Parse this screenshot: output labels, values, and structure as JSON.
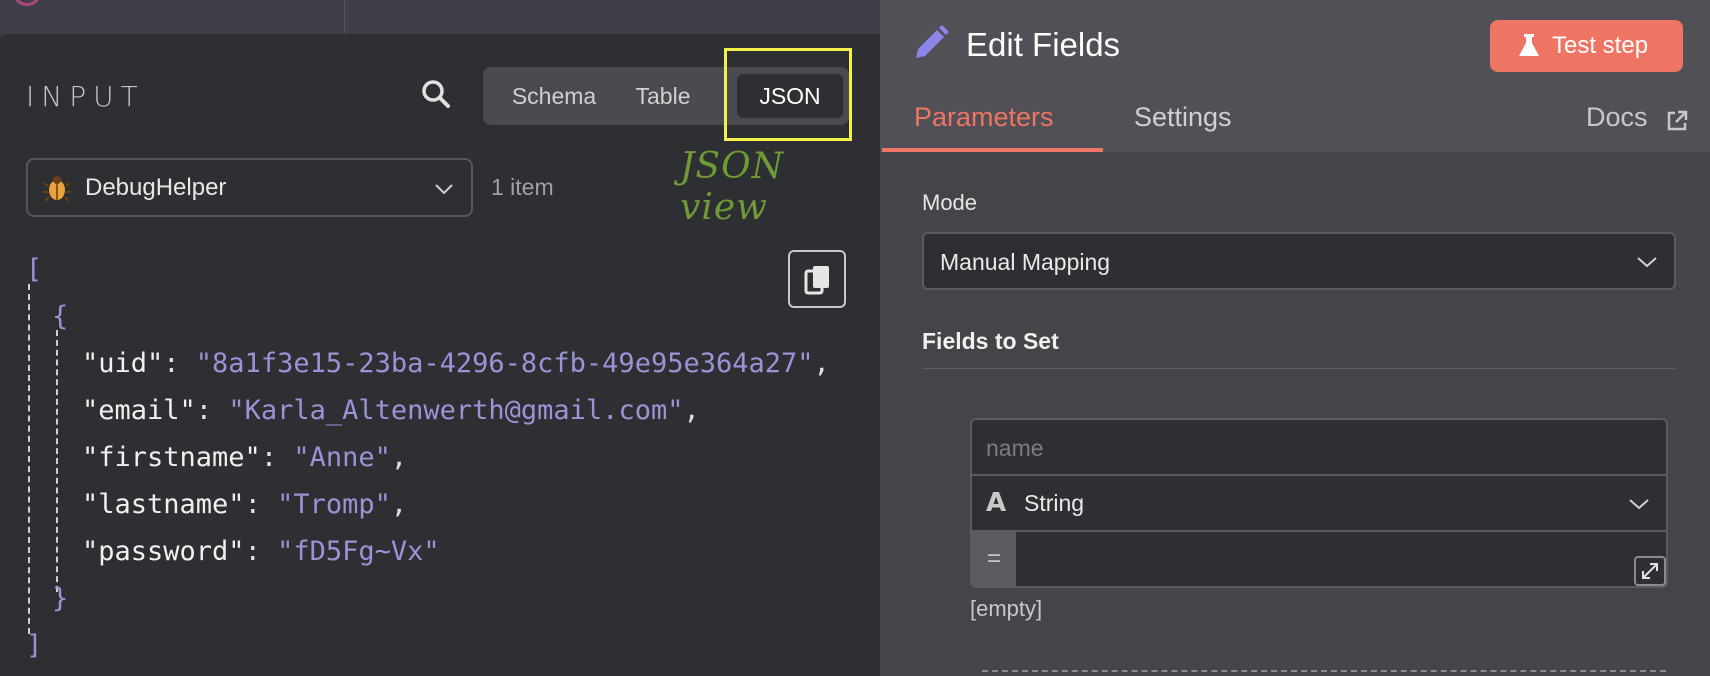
{
  "input_panel": {
    "title": "INPUT",
    "view_tabs": [
      {
        "label": "Schema",
        "active": false
      },
      {
        "label": "Table",
        "active": false
      },
      {
        "label": "JSON",
        "active": true
      }
    ],
    "annotation": "JSON view",
    "node_select": {
      "value": "DebugHelper",
      "icon": "bug-icon"
    },
    "item_count": "1 item",
    "json": {
      "open_array": "[",
      "open_object": "{",
      "entries": [
        {
          "key": "\"uid\"",
          "value": "\"8a1f3e15-23ba-4296-8cfb-49e95e364a27\"",
          "comma": ","
        },
        {
          "key": "\"email\"",
          "value": "\"Karla_Altenwerth@gmail.com\"",
          "comma": ","
        },
        {
          "key": "\"firstname\"",
          "value": "\"Anne\"",
          "comma": ","
        },
        {
          "key": "\"lastname\"",
          "value": "\"Tromp\"",
          "comma": ","
        },
        {
          "key": "\"password\"",
          "value": "\"fD5Fg~Vx\"",
          "comma": ""
        }
      ],
      "close_object": "}",
      "close_array": "]",
      "colon": ": "
    }
  },
  "right_panel": {
    "title": "Edit Fields",
    "test_step_label": "Test step",
    "tabs": [
      {
        "label": "Parameters",
        "active": true
      },
      {
        "label": "Settings",
        "active": false
      }
    ],
    "docs_label": "Docs",
    "mode": {
      "label": "Mode",
      "value": "Manual Mapping"
    },
    "fields_to_set": {
      "label": "Fields to Set",
      "name_placeholder": "name",
      "type_value": "String",
      "type_icon": "A",
      "eq_symbol": "=",
      "empty_hint": "[empty]"
    }
  },
  "colors": {
    "accent": "#ee7563",
    "highlight": "#f4f04a",
    "annotation": "#6f9a35",
    "json_string": "#9a93d6"
  }
}
